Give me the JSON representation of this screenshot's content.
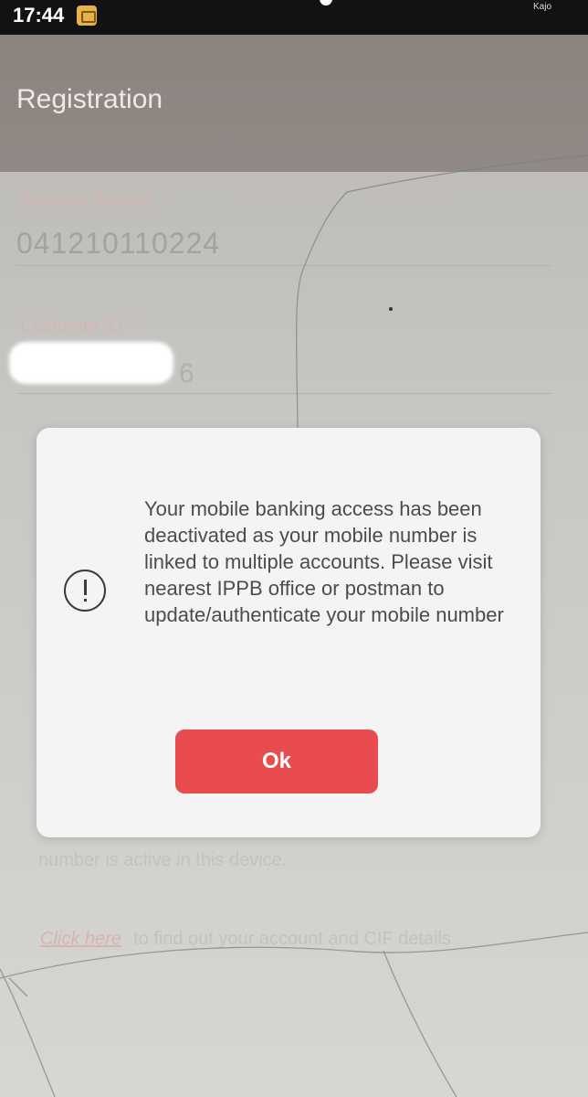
{
  "status_bar": {
    "time": "17:44",
    "right_text": "Kajo"
  },
  "app_bar": {
    "title": "Registration"
  },
  "form": {
    "account_number": {
      "label": "Account Number *",
      "value": "041210110224"
    },
    "customer_id": {
      "label": "Customer ID *",
      "visible_tail": "6"
    },
    "partial_line": "number is active in this device.",
    "link": {
      "label": "Click here",
      "suffix": "to find out your account and CIF details"
    }
  },
  "dialog": {
    "message": "Your mobile banking access has been deactivated as your mobile number is linked to multiple accounts. Please visit nearest IPPB office or postman to update/authenticate your mobile number",
    "ok_label": "Ok",
    "ok_color": "#e84c4f"
  }
}
